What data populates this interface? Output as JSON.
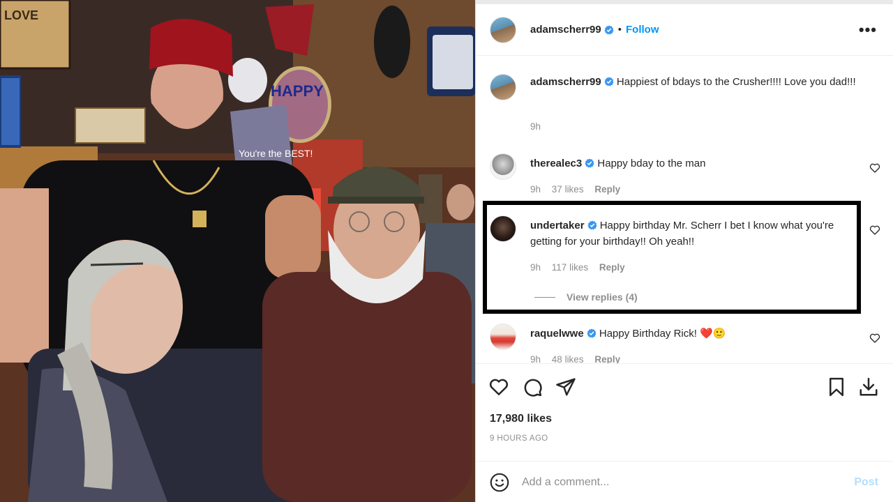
{
  "post": {
    "author": "adamscherr99",
    "follow_label": "Follow",
    "separator": "•",
    "more_label": "•••"
  },
  "comments": [
    {
      "username": "adamscherr99",
      "text": "Happiest of bdays to the Crusher!!!! Love you dad!!!",
      "time": "9h"
    },
    {
      "username": "therealec3",
      "text": "Happy bday to the man",
      "time": "9h",
      "likes": "37 likes",
      "reply": "Reply"
    },
    {
      "username": "undertaker",
      "text": "Happy birthday Mr. Scherr I bet I know what you're getting for your birthday!! Oh yeah!!",
      "time": "9h",
      "likes": "117 likes",
      "reply": "Reply",
      "view_replies": "View replies (4)"
    },
    {
      "username": "raquelwwe",
      "text": "Happy Birthday Rick! ",
      "emoji": "❤️🙂",
      "time": "9h",
      "likes": "48 likes",
      "reply": "Reply"
    }
  ],
  "stats": {
    "likes": "17,980 likes",
    "time_ago": "9 HOURS AGO"
  },
  "add_comment": {
    "placeholder": "Add a comment...",
    "post_label": "Post"
  },
  "photo_text": {
    "balloon": "HAPPY",
    "sign": "You're the BEST!",
    "bar_sign": "LOVE"
  },
  "icons": {
    "like": "heart-icon",
    "comment": "comment-bubble-icon",
    "share": "paper-plane-icon",
    "save": "bookmark-icon",
    "download": "download-icon",
    "emoji": "smiley-icon",
    "verified": "verified-badge-icon"
  },
  "colors": {
    "accent": "#0095f6",
    "post_disabled": "#b2dffc",
    "muted": "#8e8e8e",
    "verified": "#3897f0"
  }
}
